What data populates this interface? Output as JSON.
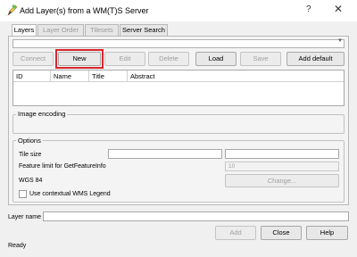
{
  "window": {
    "title": "Add Layer(s) from a WM(T)S Server",
    "help_glyph": "?",
    "close_glyph": "✕"
  },
  "tabs": [
    {
      "label": "Layers"
    },
    {
      "label": "Layer Order"
    },
    {
      "label": "Tilesets"
    },
    {
      "label": "Server Search"
    }
  ],
  "connection": {
    "selected": "",
    "buttons": {
      "connect": "Connect",
      "new": "New",
      "edit": "Edit",
      "delete": "Delete",
      "load": "Load",
      "save": "Save",
      "add_default": "Add default servers"
    }
  },
  "layers_table": {
    "columns": [
      "ID",
      "Name",
      "Title",
      "Abstract"
    ]
  },
  "image_encoding": {
    "title": "Image encoding"
  },
  "options": {
    "title": "Options",
    "tile_size_label": "Tile size",
    "tile_size_value_1": "",
    "tile_size_value_2": "",
    "feature_limit_label": "Feature limit for GetFeatureInfo",
    "feature_limit_value": "10",
    "crs_label": "WGS 84",
    "change_button": "Change...",
    "legend_checkbox_label": "Use contextual WMS Legend"
  },
  "layer_name": {
    "label": "Layer name",
    "value": ""
  },
  "footer": {
    "add": "Add",
    "close": "Close",
    "help": "Help"
  },
  "status": "Ready",
  "colors": {
    "highlight": "#d9262c"
  }
}
